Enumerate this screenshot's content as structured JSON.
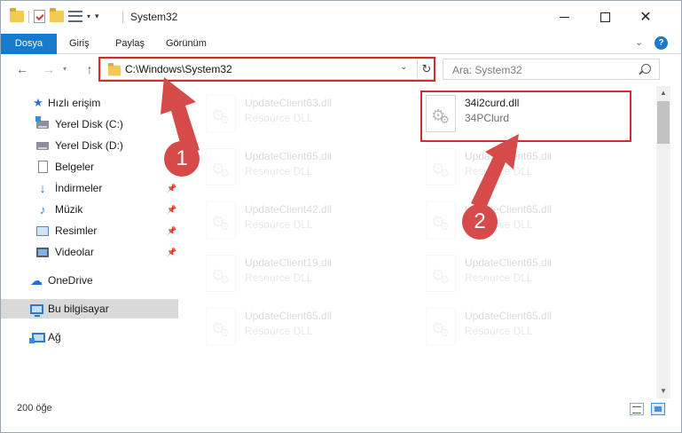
{
  "window": {
    "title": "System32"
  },
  "ribbon": {
    "tabs": [
      {
        "label": "Dosya"
      },
      {
        "label": "Giriş"
      },
      {
        "label": "Paylaş"
      },
      {
        "label": "Görünüm"
      }
    ]
  },
  "address": {
    "path": "C:\\Windows\\System32"
  },
  "search": {
    "placeholder": "Ara: System32"
  },
  "sidebar": {
    "items": [
      {
        "label": "Hızlı erişim"
      },
      {
        "label": "Yerel Disk (C:)"
      },
      {
        "label": "Yerel Disk (D:)"
      },
      {
        "label": "Belgeler"
      },
      {
        "label": "İndirmeler"
      },
      {
        "label": "Müzik"
      },
      {
        "label": "Resimler"
      },
      {
        "label": "Videolar"
      },
      {
        "label": "OneDrive"
      },
      {
        "label": "Bu bilgisayar"
      },
      {
        "label": "Ağ"
      }
    ]
  },
  "files": {
    "left": [
      {
        "name": "UpdateClient63.dll",
        "type": "Resource DLL"
      },
      {
        "name": "UpdateClient65.dll",
        "type": "Resource DLL"
      },
      {
        "name": "UpdateClient42.dll",
        "type": "Resource DLL"
      },
      {
        "name": "UpdateClient19.dll",
        "type": "Resource DLL"
      },
      {
        "name": "UpdateClient65.dll",
        "type": "Resource DLL"
      }
    ],
    "right": [
      {
        "name": "34i2curd.dll",
        "type": "34PClurd"
      },
      {
        "name": "UpdateClient65.dll",
        "type": "Resource DLL"
      },
      {
        "name": "UpdateClient65.dll",
        "type": "Resource DLL"
      },
      {
        "name": "UpdateClient65.dll",
        "type": "Resource DLL"
      },
      {
        "name": "UpdateClient65.dll",
        "type": "Resource DLL"
      }
    ]
  },
  "status": {
    "item_count": "200 öğe"
  },
  "annotations": {
    "step1": "1",
    "step2": "2",
    "color": "#d64a4a"
  }
}
